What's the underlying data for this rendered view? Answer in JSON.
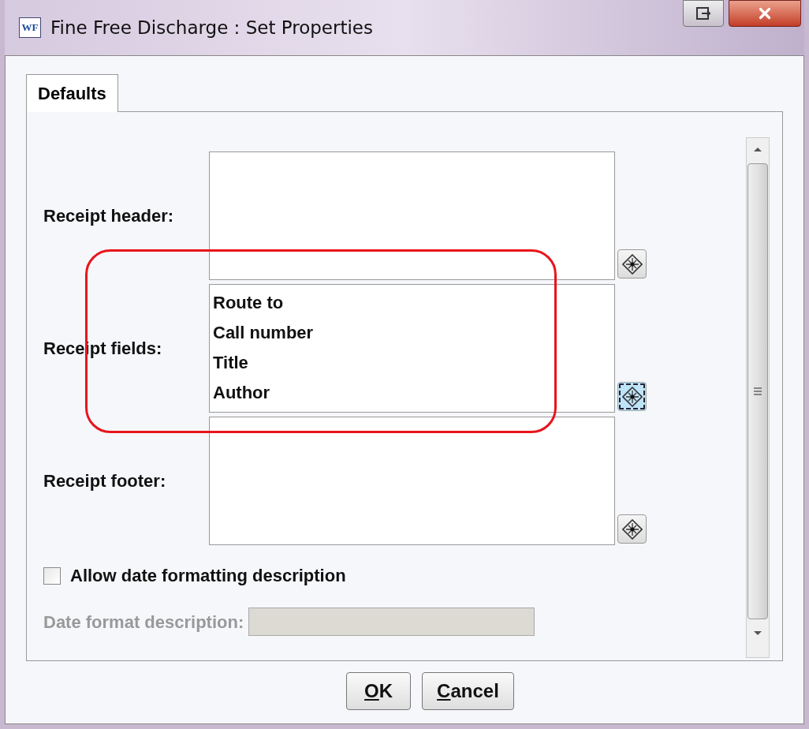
{
  "window": {
    "app_icon": "WF",
    "title": "Fine Free Discharge : Set Properties"
  },
  "tabs": [
    {
      "label": "Defaults",
      "selected": true
    }
  ],
  "fields": [
    {
      "label": "Receipt header:",
      "highlighted": false
    },
    {
      "label": "Receipt fields:",
      "lines": [
        "Route to",
        "Call number",
        "Title",
        "Author"
      ],
      "highlighted": true
    },
    {
      "label": "Receipt footer:",
      "highlighted": false
    }
  ],
  "selector_focus": [
    false,
    true,
    false
  ],
  "allow_date_formatting": {
    "label": "Allow date formatting description",
    "checked": false
  },
  "date_format": {
    "label": "Date format description:",
    "disabled": true
  },
  "buttons": [
    {
      "label": "OK"
    },
    {
      "label": "Cancel"
    }
  ]
}
